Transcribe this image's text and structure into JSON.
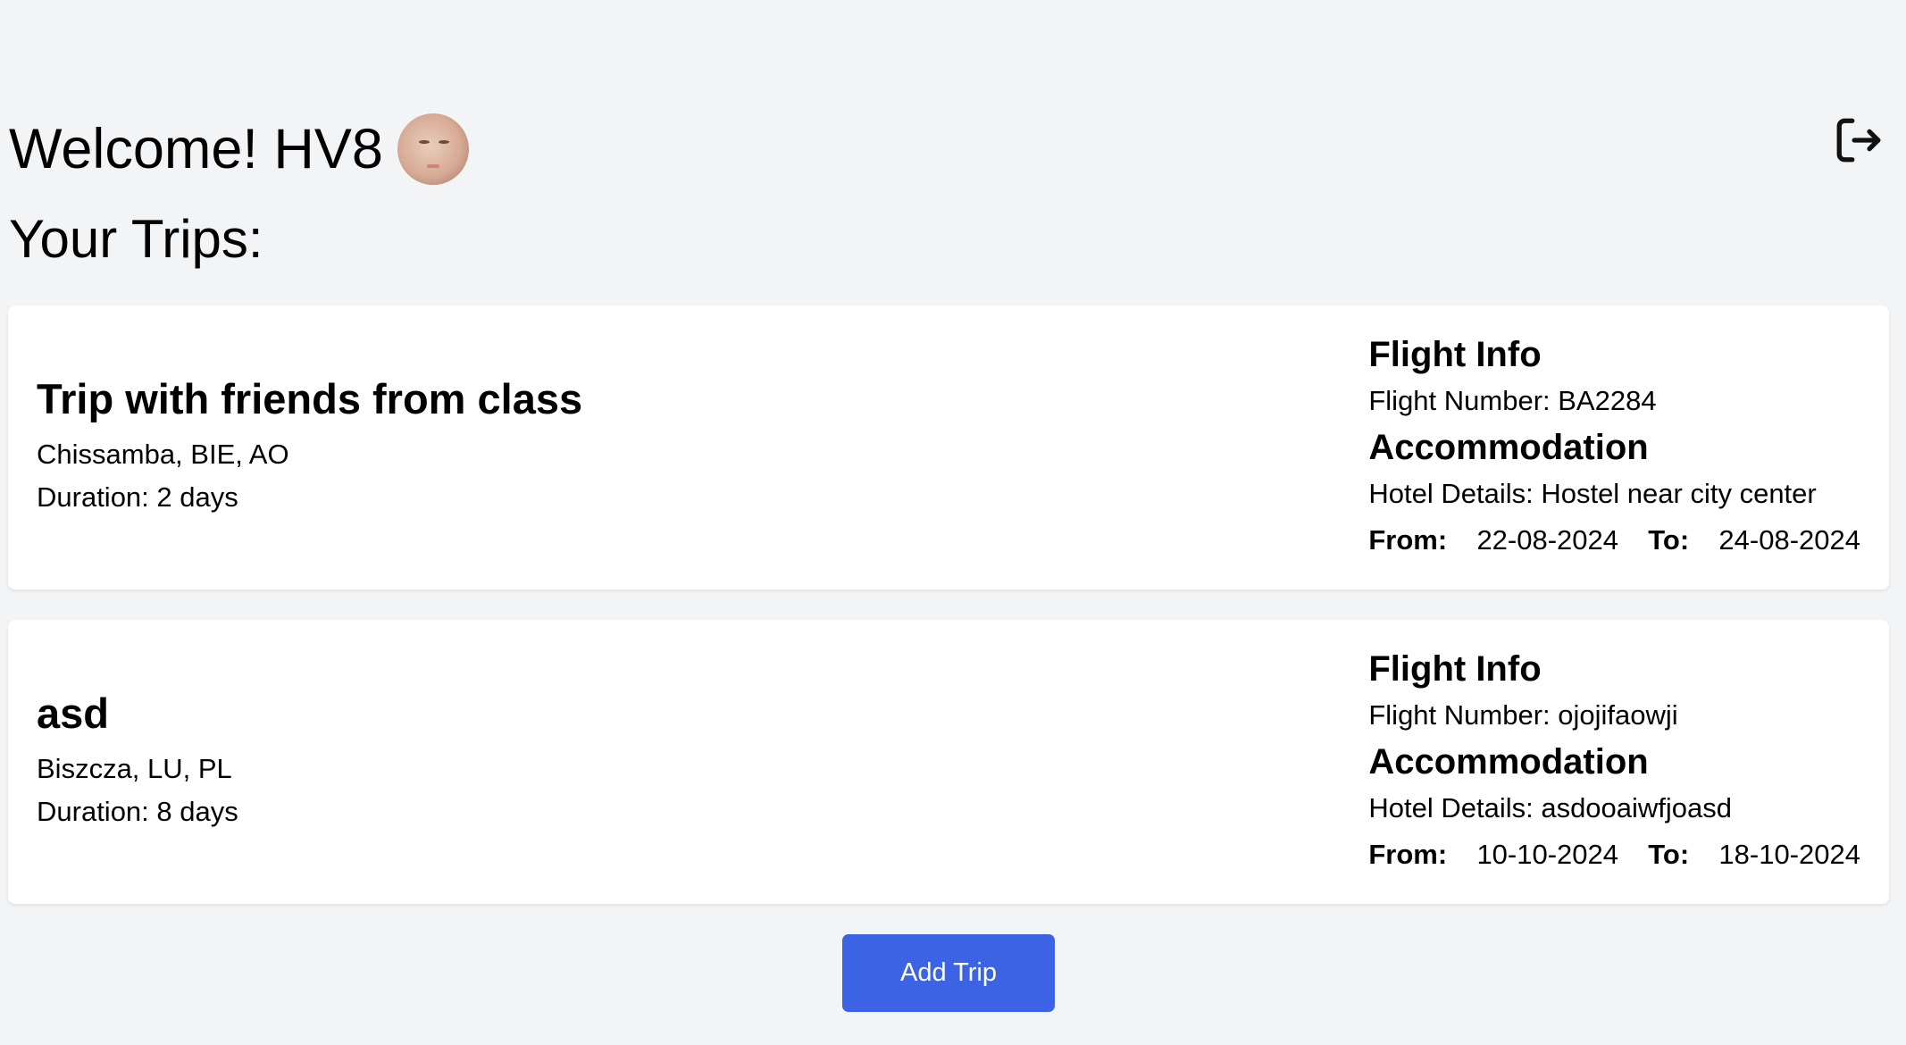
{
  "header": {
    "welcome_text": "Welcome! HV8",
    "avatar_icon": "user-avatar",
    "logout_icon": "logout-icon"
  },
  "page": {
    "title": "Your Trips:"
  },
  "trips": [
    {
      "name": "Trip with friends from class",
      "location": "Chissamba, BIE, AO",
      "duration": "Duration: 2 days",
      "flight_title": "Flight Info",
      "flight_number": "Flight Number: BA2284",
      "accommodation_title": "Accommodation",
      "hotel_details": "Hotel Details: Hostel near city center",
      "from_label": "From:",
      "from_date": "22-08-2024",
      "to_label": "To:",
      "to_date": "24-08-2024"
    },
    {
      "name": "asd",
      "location": "Biszcza, LU, PL",
      "duration": "Duration: 8 days",
      "flight_title": "Flight Info",
      "flight_number": "Flight Number: ojojifaowji",
      "accommodation_title": "Accommodation",
      "hotel_details": "Hotel Details: asdooaiwfjoasd",
      "from_label": "From:",
      "from_date": "10-10-2024",
      "to_label": "To:",
      "to_date": "18-10-2024"
    }
  ],
  "actions": {
    "add_trip_label": "Add Trip"
  },
  "colors": {
    "page_background": "#f3f4f6",
    "card_background": "#ffffff",
    "primary_button": "#3b63e4"
  }
}
